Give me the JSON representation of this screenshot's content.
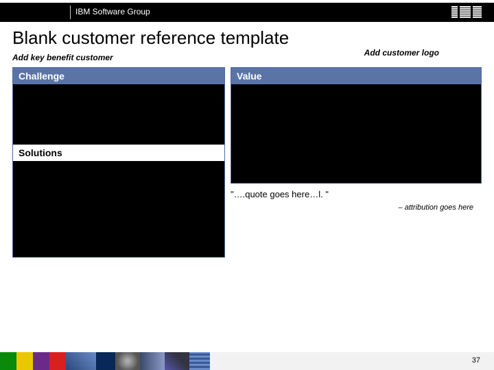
{
  "header": {
    "group_label": "IBM Software Group",
    "logo_text": "IBM"
  },
  "title": "Blank customer reference template",
  "subtitle": "Add key benefit customer",
  "logo_placeholder": "Add customer logo",
  "panels": {
    "challenge_label": "Challenge",
    "value_label": "Value",
    "solutions_label": "Solutions"
  },
  "quote": {
    "text": "\"….quote goes here…l. \"",
    "attribution": "– attribution goes here"
  },
  "page_number": "37"
}
